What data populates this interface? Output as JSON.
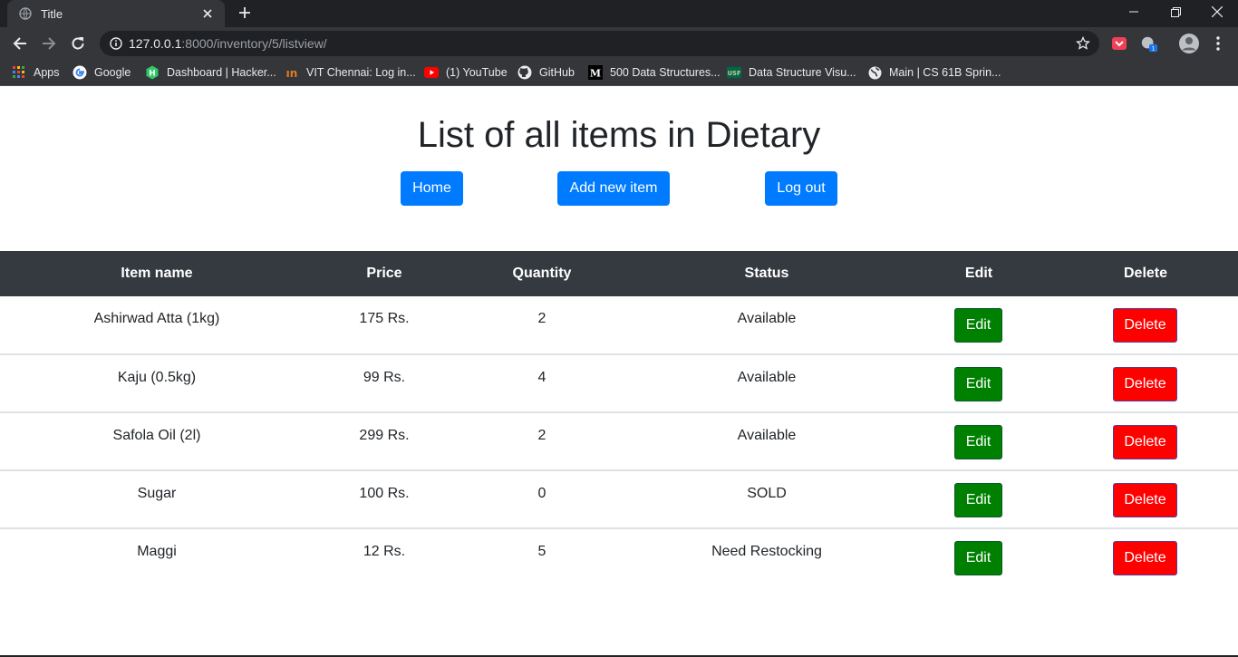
{
  "browser": {
    "tab_title": "Title",
    "url_host": "127.0.0.1",
    "url_rest": ":8000/inventory/5/listview/",
    "bookmarks": [
      {
        "label": "Apps",
        "icon": "apps-grid-icon"
      },
      {
        "label": "Google",
        "icon": "google-icon"
      },
      {
        "label": "Dashboard | Hacker...",
        "icon": "hackerrank-icon"
      },
      {
        "label": "VIT Chennai: Log in...",
        "icon": "vit-icon"
      },
      {
        "label": "(1) YouTube",
        "icon": "youtube-icon"
      },
      {
        "label": "GitHub",
        "icon": "github-icon"
      },
      {
        "label": "500 Data Structures...",
        "icon": "medium-icon"
      },
      {
        "label": "Data Structure Visu...",
        "icon": "usf-icon"
      },
      {
        "label": "Main | CS 61B Sprin...",
        "icon": "globe-icon"
      }
    ]
  },
  "page": {
    "title": "List of all items in Dietary",
    "buttons": {
      "home": "Home",
      "add": "Add new item",
      "logout": "Log out"
    }
  },
  "table": {
    "headers": [
      "Item name",
      "Price",
      "Quantity",
      "Status",
      "Edit",
      "Delete"
    ],
    "rows": [
      {
        "name": "Ashirwad Atta (1kg)",
        "price": "175 Rs.",
        "quantity": "2",
        "status": "Available",
        "edit": "Edit",
        "delete": "Delete"
      },
      {
        "name": "Kaju (0.5kg)",
        "price": "99 Rs.",
        "quantity": "4",
        "status": "Available",
        "edit": "Edit",
        "delete": "Delete"
      },
      {
        "name": "Safola Oil (2l)",
        "price": "299 Rs.",
        "quantity": "2",
        "status": "Available",
        "edit": "Edit",
        "delete": "Delete"
      },
      {
        "name": "Sugar",
        "price": "100 Rs.",
        "quantity": "0",
        "status": "SOLD",
        "edit": "Edit",
        "delete": "Delete"
      },
      {
        "name": "Maggi",
        "price": "12 Rs.",
        "quantity": "5",
        "status": "Need Restocking",
        "edit": "Edit",
        "delete": "Delete"
      }
    ]
  },
  "colors": {
    "primary": "#007bff",
    "edit": "#008000",
    "delete": "#ff0000",
    "thead": "#343a40"
  }
}
